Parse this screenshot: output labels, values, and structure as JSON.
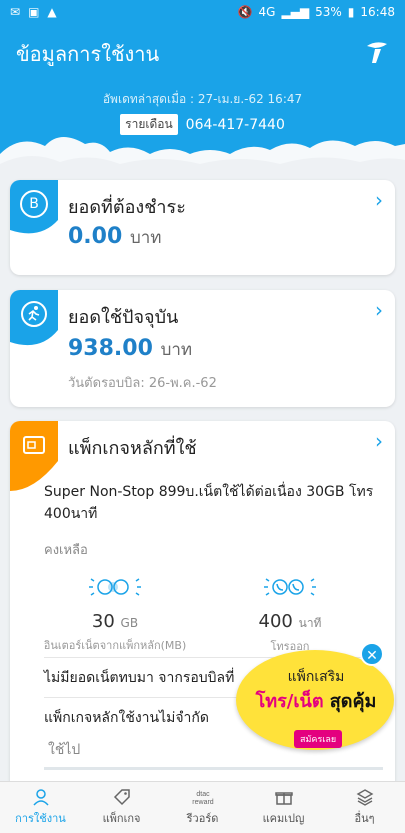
{
  "status_bar": {
    "battery": "53%",
    "time": "16:48",
    "network": "4G"
  },
  "header": {
    "title": "ข้อมูลการใช้งาน",
    "updated": "อัพเดทล่าสุดเมื่อ : 27-เม.ย.-62 16:47",
    "plan_badge": "รายเดือน",
    "account_number": "064-417-7440"
  },
  "card_due": {
    "title": "ยอดที่ต้องชำระ",
    "amount": "0.00",
    "unit": "บาท",
    "icon_letter": "B"
  },
  "card_usage": {
    "title": "ยอดใช้ปัจจุบัน",
    "amount": "938.00",
    "unit": "บาท",
    "cycle": "วันตัดรอบบิล: 26-พ.ค.-62"
  },
  "card_package": {
    "title": "แพ็กเกจหลักที่ใช้",
    "name": "Super Non-Stop 899บ.เน็ตใช้ได้ต่อเนื่อง 30GB โทร 400นาที",
    "remaining_label": "คงเหลือ",
    "data": {
      "value": "30",
      "unit": "GB",
      "label": "อินเตอร์เน็ตจากแพ็กหลัก(MB)"
    },
    "voice": {
      "value": "400",
      "unit": "นาที",
      "label": "โทรออก"
    },
    "no_rollover": "ไม่มียอดเน็ตทบมา จากรอบบิลที่",
    "unlimited_label": "แพ็กเกจหลักใช้งานไม่จำกัด",
    "unlimited_value": "ใช้ไป"
  },
  "promo": {
    "line1": "แพ็กเสริม",
    "line2a": "โทร/เน็ต",
    "line2b": "สุดคุ้ม",
    "button": "สมัครเลย"
  },
  "bottom_nav": [
    {
      "label": "การใช้งาน",
      "icon": "person-icon"
    },
    {
      "label": "แพ็กเกจ",
      "icon": "tag-icon"
    },
    {
      "label": "รีวอร์ด",
      "icon": "dtac-reward-icon"
    },
    {
      "label": "แคมเปญ",
      "icon": "gift-icon"
    },
    {
      "label": "อื่นๆ",
      "icon": "layers-icon"
    }
  ],
  "colors": {
    "brand": "#1aa3e8",
    "orange": "#ff9900",
    "pink": "#e4007f",
    "yellow": "#ffe23a"
  }
}
